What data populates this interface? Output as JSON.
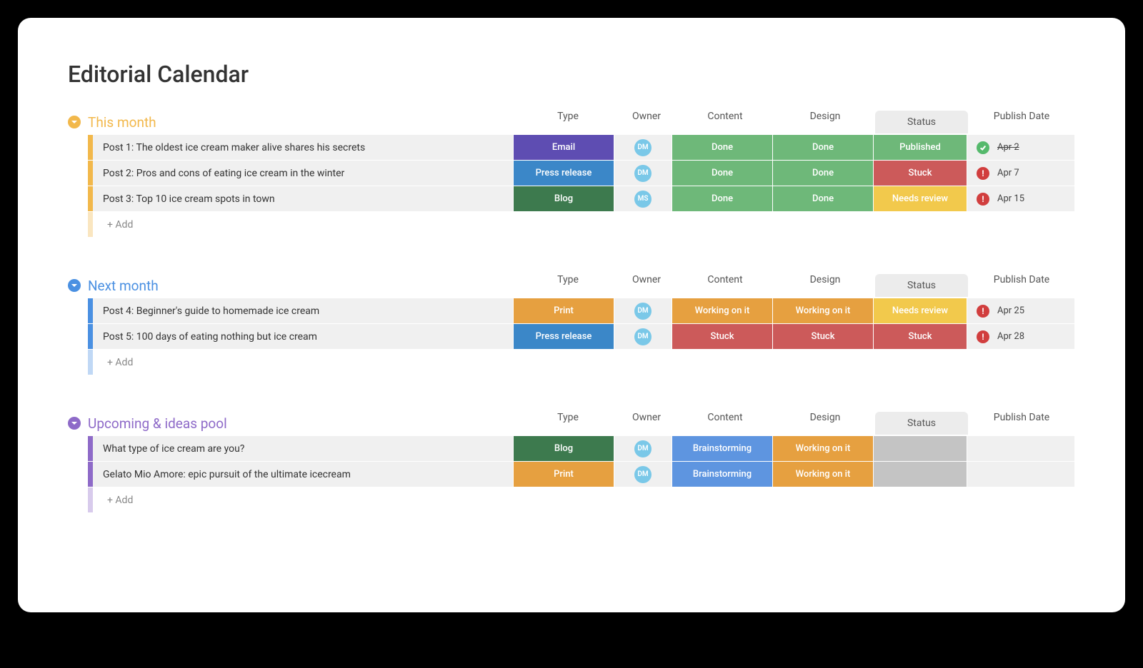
{
  "title": "Editorial Calendar",
  "columns": {
    "type": "Type",
    "owner": "Owner",
    "content": "Content",
    "design": "Design",
    "status": "Status",
    "publish": "Publish Date"
  },
  "add_label": "+ Add",
  "colors": {
    "email": "#5e4db2",
    "press": "#3b87c8",
    "blog": "#3d7a4e",
    "print": "#e6a040",
    "done": "#6eb879",
    "published": "#6eb879",
    "stuck": "#cc5a5a",
    "needs_review": "#f2c94c",
    "working": "#e6a040",
    "brainstorm": "#5e95e0",
    "gray": "#c4c4c4"
  },
  "groups": [
    {
      "name": "This month",
      "color": "#f2b84b",
      "rows": [
        {
          "name": "Post 1: The oldest ice cream maker alive shares his secrets",
          "type": "Email",
          "type_color": "email",
          "owner": "DM",
          "content": "Done",
          "content_color": "done",
          "design": "Done",
          "design_color": "done",
          "status": "Published",
          "status_color": "published",
          "date": "Apr 2",
          "date_icon": "check",
          "date_strike": true
        },
        {
          "name": "Post 2: Pros and cons of eating ice cream in the winter",
          "type": "Press release",
          "type_color": "press",
          "owner": "DM",
          "content": "Done",
          "content_color": "done",
          "design": "Done",
          "design_color": "done",
          "status": "Stuck",
          "status_color": "stuck",
          "date": "Apr 7",
          "date_icon": "alert"
        },
        {
          "name": "Post 3: Top 10 ice cream spots in town",
          "type": "Blog",
          "type_color": "blog",
          "owner": "MS",
          "content": "Done",
          "content_color": "done",
          "design": "Done",
          "design_color": "done",
          "status": "Needs review",
          "status_color": "needs_review",
          "date": "Apr 15",
          "date_icon": "alert"
        }
      ]
    },
    {
      "name": "Next month",
      "color": "#4a90e2",
      "rows": [
        {
          "name": "Post 4: Beginner's guide to homemade ice cream",
          "type": "Print",
          "type_color": "print",
          "owner": "DM",
          "content": "Working on it",
          "content_color": "working",
          "design": "Working on it",
          "design_color": "working",
          "status": "Needs review",
          "status_color": "needs_review",
          "date": "Apr 25",
          "date_icon": "alert"
        },
        {
          "name": "Post 5: 100 days of eating nothing but ice cream",
          "type": "Press release",
          "type_color": "press",
          "owner": "DM",
          "content": "Stuck",
          "content_color": "stuck",
          "design": "Stuck",
          "design_color": "stuck",
          "status": "Stuck",
          "status_color": "stuck",
          "date": "Apr 28",
          "date_icon": "alert"
        }
      ]
    },
    {
      "name": "Upcoming & ideas pool",
      "color": "#8e6ac8",
      "rows": [
        {
          "name": "What type of ice cream are you?",
          "type": "Blog",
          "type_color": "blog",
          "owner": "DM",
          "content": "Brainstorming",
          "content_color": "brainstorm",
          "design": "Working on it",
          "design_color": "working",
          "status": "",
          "status_color": "gray",
          "date": ""
        },
        {
          "name": "Gelato Mio Amore: epic pursuit of the ultimate icecream",
          "type": "Print",
          "type_color": "print",
          "owner": "DM",
          "content": "Brainstorming",
          "content_color": "brainstorm",
          "design": "Working on it",
          "design_color": "working",
          "status": "",
          "status_color": "gray",
          "date": ""
        }
      ]
    }
  ]
}
